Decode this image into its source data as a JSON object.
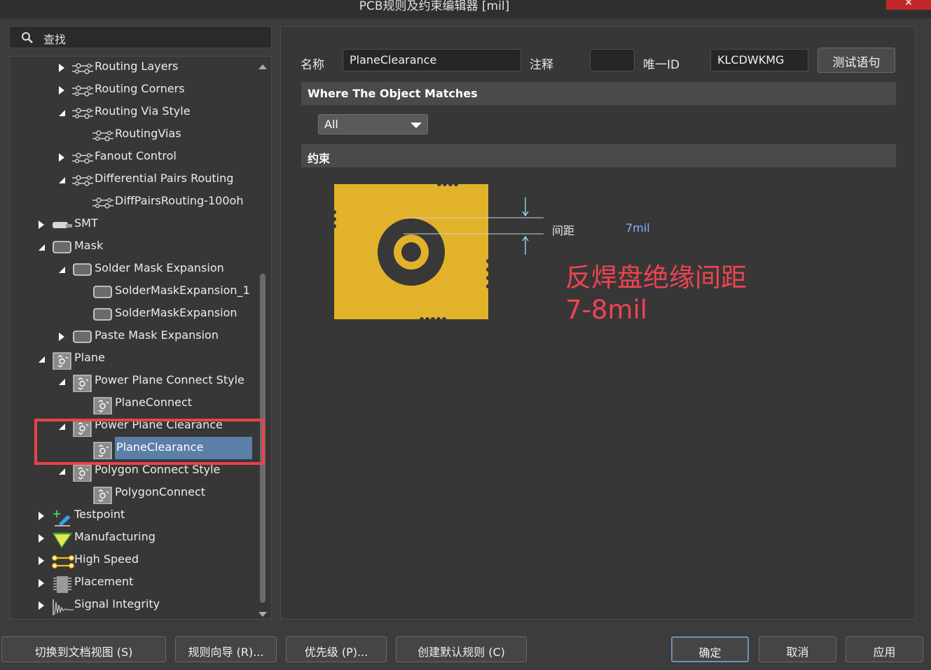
{
  "window": {
    "title": "PCB规则及约束编辑器 [mil]",
    "close_label": "✕"
  },
  "search": {
    "placeholder": "查找",
    "icon": "search-icon"
  },
  "tree": {
    "items": [
      {
        "label": "Routing Layers",
        "level": 2,
        "state": "collapsed",
        "icon": "routing-rule-icon"
      },
      {
        "label": "Routing Corners",
        "level": 2,
        "state": "collapsed",
        "icon": "routing-rule-icon"
      },
      {
        "label": "Routing Via Style",
        "level": 2,
        "state": "expanded",
        "icon": "routing-rule-icon"
      },
      {
        "label": "RoutingVias",
        "level": 3,
        "state": "leaf",
        "icon": "routing-rule-icon"
      },
      {
        "label": "Fanout Control",
        "level": 2,
        "state": "collapsed",
        "icon": "routing-rule-icon"
      },
      {
        "label": "Differential Pairs Routing",
        "level": 2,
        "state": "expanded",
        "icon": "routing-rule-icon"
      },
      {
        "label": "DiffPairsRouting-100oh",
        "level": 3,
        "state": "leaf",
        "icon": "routing-rule-icon"
      },
      {
        "label": "SMT",
        "level": 1,
        "state": "collapsed",
        "icon": "smt-icon"
      },
      {
        "label": "Mask",
        "level": 1,
        "state": "expanded",
        "icon": "mask-icon"
      },
      {
        "label": "Solder Mask Expansion",
        "level": 2,
        "state": "expanded",
        "icon": "mask-icon"
      },
      {
        "label": "SolderMaskExpansion_1",
        "level": 3,
        "state": "leaf",
        "icon": "mask-icon"
      },
      {
        "label": "SolderMaskExpansion",
        "level": 3,
        "state": "leaf",
        "icon": "mask-icon"
      },
      {
        "label": "Paste Mask Expansion",
        "level": 2,
        "state": "collapsed",
        "icon": "mask-icon"
      },
      {
        "label": "Plane",
        "level": 1,
        "state": "expanded",
        "icon": "plane-icon"
      },
      {
        "label": "Power Plane Connect Style",
        "level": 2,
        "state": "expanded",
        "icon": "plane-icon"
      },
      {
        "label": "PlaneConnect",
        "level": 3,
        "state": "leaf",
        "icon": "plane-icon"
      },
      {
        "label": "Power Plane Clearance",
        "level": 2,
        "state": "expanded",
        "icon": "plane-icon"
      },
      {
        "label": "PlaneClearance",
        "level": 3,
        "state": "selected",
        "icon": "plane-icon"
      },
      {
        "label": "Polygon Connect Style",
        "level": 2,
        "state": "expanded",
        "icon": "plane-icon"
      },
      {
        "label": "PolygonConnect",
        "level": 3,
        "state": "leaf",
        "icon": "plane-icon"
      },
      {
        "label": "Testpoint",
        "level": 1,
        "state": "collapsed",
        "icon": "testpoint-icon"
      },
      {
        "label": "Manufacturing",
        "level": 1,
        "state": "collapsed",
        "icon": "manufacturing-icon"
      },
      {
        "label": "High Speed",
        "level": 1,
        "state": "collapsed",
        "icon": "high-speed-icon"
      },
      {
        "label": "Placement",
        "level": 1,
        "state": "collapsed",
        "icon": "placement-icon"
      },
      {
        "label": "Signal Integrity",
        "level": 1,
        "state": "collapsed",
        "icon": "signal-integrity-icon"
      }
    ]
  },
  "rule": {
    "name_label": "名称",
    "name_value": "PlaneClearance",
    "comment_label": "注释",
    "comment_value": "",
    "uid_label": "唯一ID",
    "uid_value": "KLCDWKMG",
    "test_button": "测试语句"
  },
  "where": {
    "header": "Where The Object Matches",
    "selected": "All"
  },
  "constraints": {
    "header": "约束",
    "clearance_label": "间距",
    "clearance_value": "7mil",
    "annotation_line1": "反焊盘绝缘间距",
    "annotation_line2": "7-8mil",
    "colors": {
      "copper": "#e2b22a",
      "pad": "#383838",
      "annotation": "#ef4350",
      "value": "#7fb0ff"
    }
  },
  "bottom": {
    "switch_view": "切换到文档视图 (S)",
    "rule_wizard": "规则向导 (R)...",
    "priority": "优先级 (P)...",
    "create_default": "创建默认规则 (C)",
    "ok": "确定",
    "cancel": "取消",
    "apply": "应用"
  }
}
